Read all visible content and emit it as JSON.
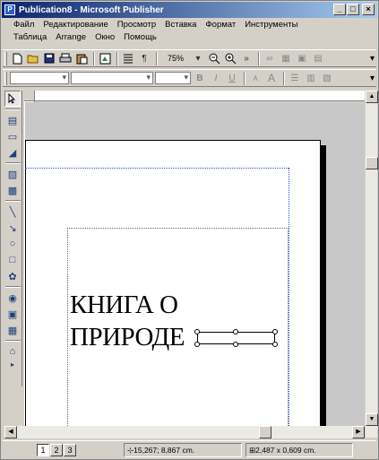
{
  "window": {
    "title": "Publication8 - Microsoft Publisher",
    "icon_name": "publisher-app-icon",
    "minimize": "_",
    "maximize": "□",
    "close": "×"
  },
  "menu": [
    "Файл",
    "Редактирование",
    "Просмотр",
    "Вставка",
    "Формат",
    "Инструменты",
    "Таблица",
    "Arrange",
    "Окно",
    "Помощь"
  ],
  "toolbar": {
    "zoom": "75%",
    "icons": [
      "new-icon",
      "open-icon",
      "save-icon",
      "print-icon",
      "paste-icon",
      "format-painter-icon",
      "align-icon",
      "paragraph-icon",
      "zoom-out-icon",
      "zoom-in-icon",
      "more-icon"
    ]
  },
  "format_toolbar": {
    "bold": "B",
    "italic": "I",
    "underline": "U",
    "font_size_small": "A",
    "font_size_large": "A"
  },
  "document": {
    "line1": "КНИГА О",
    "line2": "ПРИРОДЕ"
  },
  "status": {
    "pages": [
      "1",
      "2",
      "3"
    ],
    "position": "15,267; 8,867 cm.",
    "size": "2,487 x 0,609 cm."
  }
}
